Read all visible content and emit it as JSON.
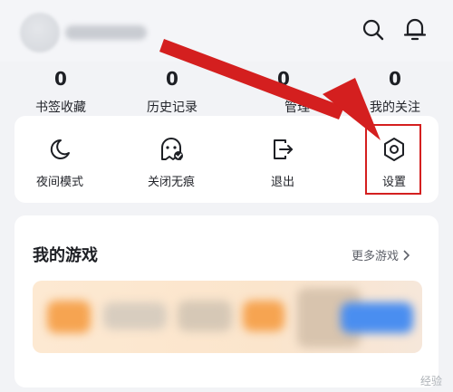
{
  "stats": [
    {
      "count": "0",
      "label": "书签收藏"
    },
    {
      "count": "0",
      "label": "历史记录"
    },
    {
      "count": "0",
      "label": "管理"
    },
    {
      "count": "0",
      "label": "我的关注"
    }
  ],
  "tools": [
    {
      "label": "夜间模式",
      "icon": "moon-icon"
    },
    {
      "label": "关闭无痕",
      "icon": "ghost-icon"
    },
    {
      "label": "退出",
      "icon": "logout-icon"
    },
    {
      "label": "设置",
      "icon": "settings-hexagon-icon"
    }
  ],
  "games": {
    "title": "我的游戏",
    "more_label": "更多游戏"
  },
  "watermark": "经验",
  "colors": {
    "arrow_red": "#d41f1f",
    "background": "#f2f3f6",
    "card": "#ffffff"
  }
}
